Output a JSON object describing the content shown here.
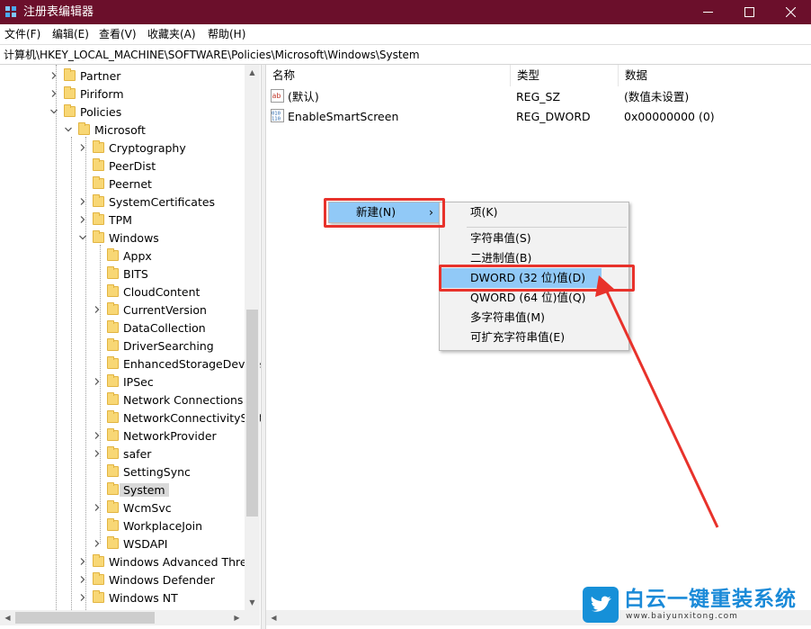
{
  "window": {
    "title": "注册表编辑器"
  },
  "menu": [
    "文件(F)",
    "编辑(E)",
    "查看(V)",
    "收藏夹(A)",
    "帮助(H)"
  ],
  "address": "计算机\\HKEY_LOCAL_MACHINE\\SOFTWARE\\Policies\\Microsoft\\Windows\\System",
  "tree": [
    {
      "label": "Partner",
      "expander": "collapsed"
    },
    {
      "label": "Piriform",
      "expander": "collapsed"
    },
    {
      "label": "Policies",
      "expander": "expanded"
    },
    {
      "label": "Microsoft",
      "expander": "expanded"
    },
    {
      "label": "Cryptography",
      "expander": "collapsed"
    },
    {
      "label": "PeerDist",
      "expander": "none"
    },
    {
      "label": "Peernet",
      "expander": "none"
    },
    {
      "label": "SystemCertificates",
      "expander": "collapsed"
    },
    {
      "label": "TPM",
      "expander": "collapsed"
    },
    {
      "label": "Windows",
      "expander": "expanded"
    },
    {
      "label": "Appx",
      "expander": "none"
    },
    {
      "label": "BITS",
      "expander": "none"
    },
    {
      "label": "CloudContent",
      "expander": "none"
    },
    {
      "label": "CurrentVersion",
      "expander": "collapsed"
    },
    {
      "label": "DataCollection",
      "expander": "none"
    },
    {
      "label": "DriverSearching",
      "expander": "none"
    },
    {
      "label": "EnhancedStorageDevices",
      "expander": "none"
    },
    {
      "label": "IPSec",
      "expander": "collapsed"
    },
    {
      "label": "Network Connections",
      "expander": "none"
    },
    {
      "label": "NetworkConnectivityStatusIndicator",
      "expander": "none"
    },
    {
      "label": "NetworkProvider",
      "expander": "collapsed"
    },
    {
      "label": "safer",
      "expander": "collapsed"
    },
    {
      "label": "SettingSync",
      "expander": "none"
    },
    {
      "label": "System",
      "expander": "none",
      "selected": true
    },
    {
      "label": "WcmSvc",
      "expander": "collapsed"
    },
    {
      "label": "WorkplaceJoin",
      "expander": "none"
    },
    {
      "label": "WSDAPI",
      "expander": "collapsed"
    },
    {
      "label": "Windows Advanced Threat Protection",
      "expander": "collapsed"
    },
    {
      "label": "Windows Defender",
      "expander": "collapsed"
    },
    {
      "label": "Windows NT",
      "expander": "collapsed"
    }
  ],
  "columns": {
    "name": "名称",
    "type": "类型",
    "data": "数据"
  },
  "values": [
    {
      "name": "(默认)",
      "type": "REG_SZ",
      "data": "(数值未设置)",
      "icon": "string-value-icon"
    },
    {
      "name": "EnableSmartScreen",
      "type": "REG_DWORD",
      "data": "0x00000000 (0)",
      "icon": "binary-value-icon"
    }
  ],
  "context_menu": {
    "new_label": "新建(N)"
  },
  "submenu": {
    "key": "项(K)",
    "items": [
      "字符串值(S)",
      "二进制值(B)",
      "DWORD (32 位)值(D)",
      "QWORD (64 位)值(Q)",
      "多字符串值(M)",
      "可扩充字符串值(E)"
    ],
    "highlighted": "DWORD (32 位)值(D)"
  },
  "watermark": {
    "brand": "白云一键重装系统",
    "url": "www.baiyunxitong.com"
  },
  "colors": {
    "titlebar": "#6b0f2b",
    "highlight": "#91c9f7",
    "annotation": "#e8322b",
    "brand": "#1a8ad8"
  }
}
